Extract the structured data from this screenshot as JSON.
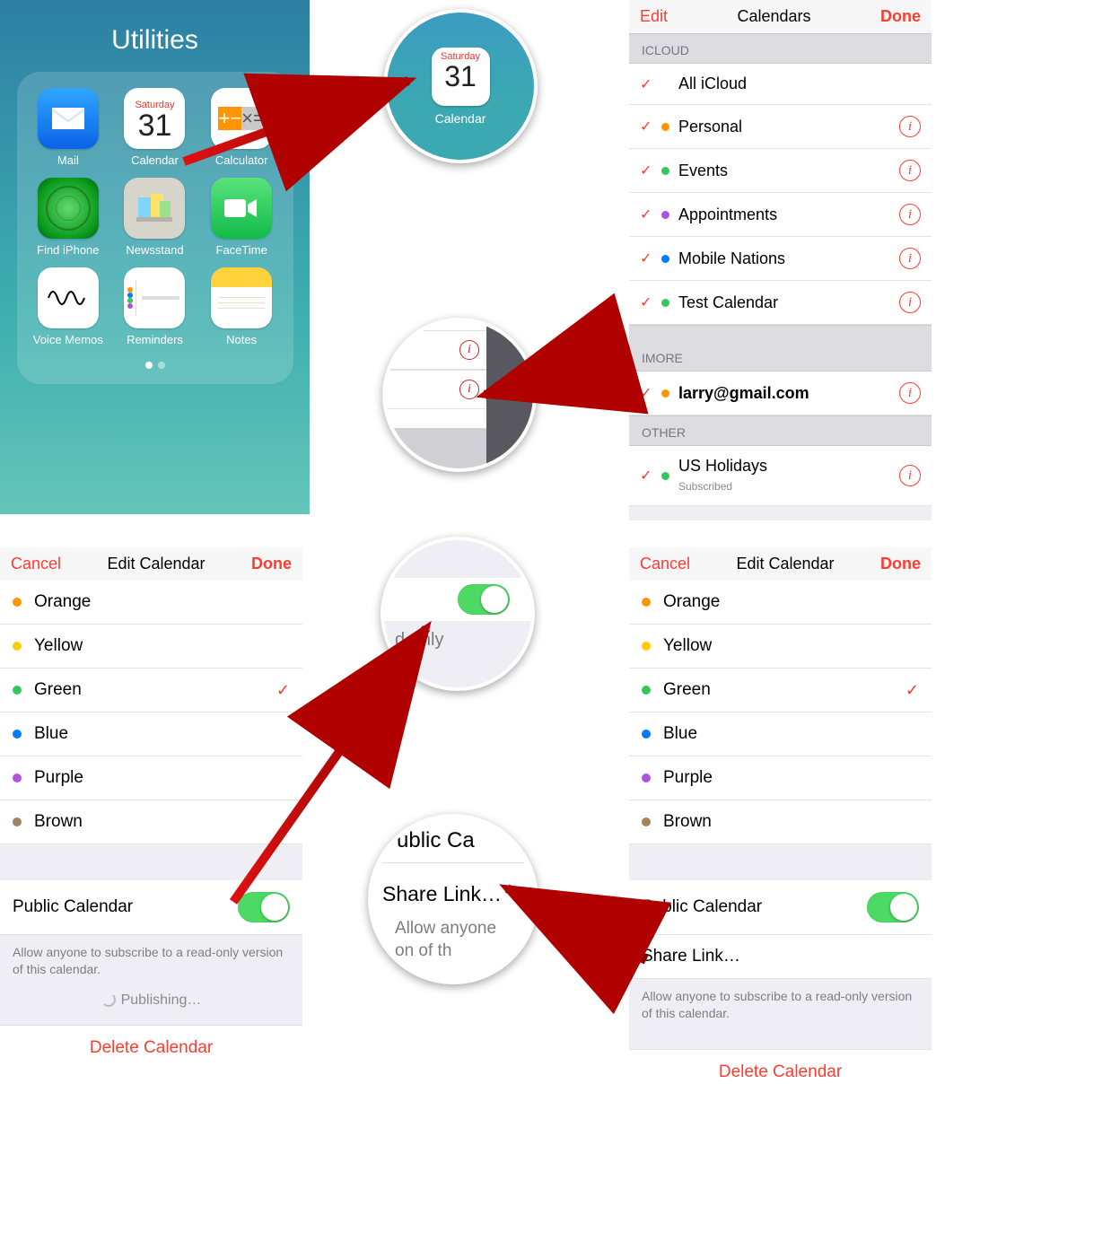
{
  "utilities": {
    "title": "Utilities",
    "apps": {
      "mail": "Mail",
      "calendar": "Calendar",
      "calendar_day_of_week": "Saturday",
      "calendar_day": "31",
      "calculator": "Calculator",
      "find_iphone": "Find iPhone",
      "newsstand": "Newsstand",
      "facetime": "FaceTime",
      "voice_memos": "Voice Memos",
      "reminders": "Reminders",
      "notes": "Notes"
    }
  },
  "zoom1": {
    "day_of_week": "Saturday",
    "day": "31",
    "label": "Calendar"
  },
  "zoom3": {
    "text": "d-only"
  },
  "zoom4": {
    "top": "Public Ca",
    "mid": "Share Link…",
    "bottom_top": "Allow anyone",
    "bottom_bot": "on of th"
  },
  "calendars": {
    "edit": "Edit",
    "title": "Calendars",
    "done": "Done",
    "sections": {
      "icloud": "ICLOUD",
      "imore": "IMORE",
      "other": "OTHER"
    },
    "items": {
      "all_icloud": "All iCloud",
      "personal": {
        "label": "Personal",
        "color": "#ff9500"
      },
      "events": {
        "label": "Events",
        "color": "#34c759"
      },
      "appts": {
        "label": "Appointments",
        "color": "#af52de"
      },
      "mobile": {
        "label": "Mobile Nations",
        "color": "#007aff"
      },
      "test": {
        "label": "Test Calendar",
        "color": "#34c759"
      },
      "imore": {
        "label": "larry@gmail.com",
        "color": "#ff9500"
      },
      "us": {
        "label": "US Holidays",
        "sub": "Subscribed",
        "color": "#34c759"
      }
    }
  },
  "edit": {
    "cancel": "Cancel",
    "title": "Edit Calendar",
    "done": "Done",
    "colors": {
      "orange": {
        "label": "Orange",
        "c": "#ff9500"
      },
      "yellow": {
        "label": "Yellow",
        "c": "#ffcc00"
      },
      "green": {
        "label": "Green",
        "c": "#34c759"
      },
      "blue": {
        "label": "Blue",
        "c": "#007aff"
      },
      "purple": {
        "label": "Purple",
        "c": "#af52de"
      },
      "brown": {
        "label": "Brown",
        "c": "#a2845e"
      }
    },
    "public_calendar": "Public Calendar",
    "share_link": "Share Link…",
    "allow_desc": "Allow anyone to subscribe to a read-only version of this calendar.",
    "publishing": "Publishing…",
    "delete": "Delete Calendar"
  }
}
